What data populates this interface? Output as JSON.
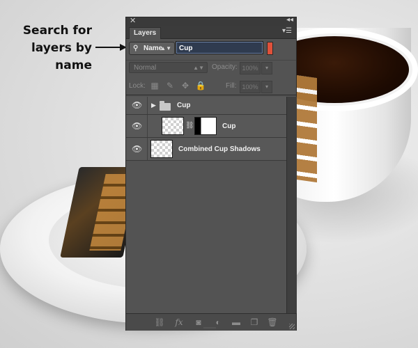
{
  "callout": {
    "lines": [
      "Search for",
      "layers by",
      "name"
    ]
  },
  "panel": {
    "tab_label": "Layers",
    "filter": {
      "type_label": "Name",
      "value": "Cup"
    },
    "blend_mode": "Normal",
    "opacity_label": "Opacity:",
    "opacity_value": "100%",
    "lock_label": "Lock:",
    "fill_label": "Fill:",
    "fill_value": "100%",
    "layers": [
      {
        "name": "Cup",
        "kind": "group"
      },
      {
        "name": "Cup",
        "kind": "layer-with-mask"
      },
      {
        "name": "Combined Cup Shadows",
        "kind": "layer"
      }
    ]
  },
  "colors": {
    "panel_bg": "#535353",
    "filter_toggle": "#e0513a",
    "input_bg": "#2f3b4f"
  },
  "icons": [
    "close-icon",
    "collapse-icon",
    "panel-menu-icon",
    "search-icon",
    "eye-icon",
    "chain-link-icon",
    "folder-icon",
    "link-icon",
    "fx-icon",
    "mask-icon",
    "adjustment-icon",
    "new-group-icon",
    "new-layer-icon",
    "trash-icon"
  ]
}
